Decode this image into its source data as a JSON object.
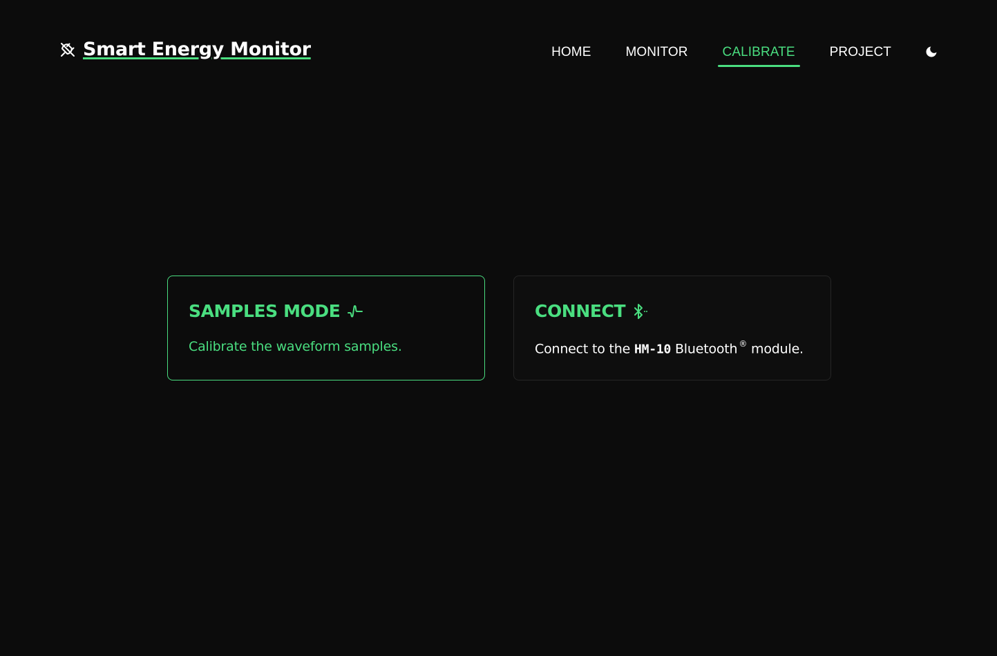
{
  "header": {
    "brand_title": "Smart Energy Monitor",
    "brand_icon": "plug-off-icon",
    "nav": [
      {
        "label": "HOME"
      },
      {
        "label": "MONITOR"
      },
      {
        "label": "CALIBRATE",
        "active": true
      },
      {
        "label": "PROJECT"
      }
    ],
    "theme_icon": "moon-icon"
  },
  "cards": {
    "samples": {
      "title": "SAMPLES MODE",
      "icon": "waveform-icon",
      "description": "Calibrate the waveform samples.",
      "active": true
    },
    "connect": {
      "title": "CONNECT",
      "icon": "bluetooth-connected-icon",
      "desc_prefix": "Connect to the ",
      "desc_code": "HM-10",
      "desc_brand": " Bluetooth",
      "desc_reg": "®",
      "desc_suffix": " module."
    }
  },
  "colors": {
    "background": "#0c0c0c",
    "accent": "#4ade80",
    "text": "#ffffff",
    "card_border": "#262626"
  }
}
